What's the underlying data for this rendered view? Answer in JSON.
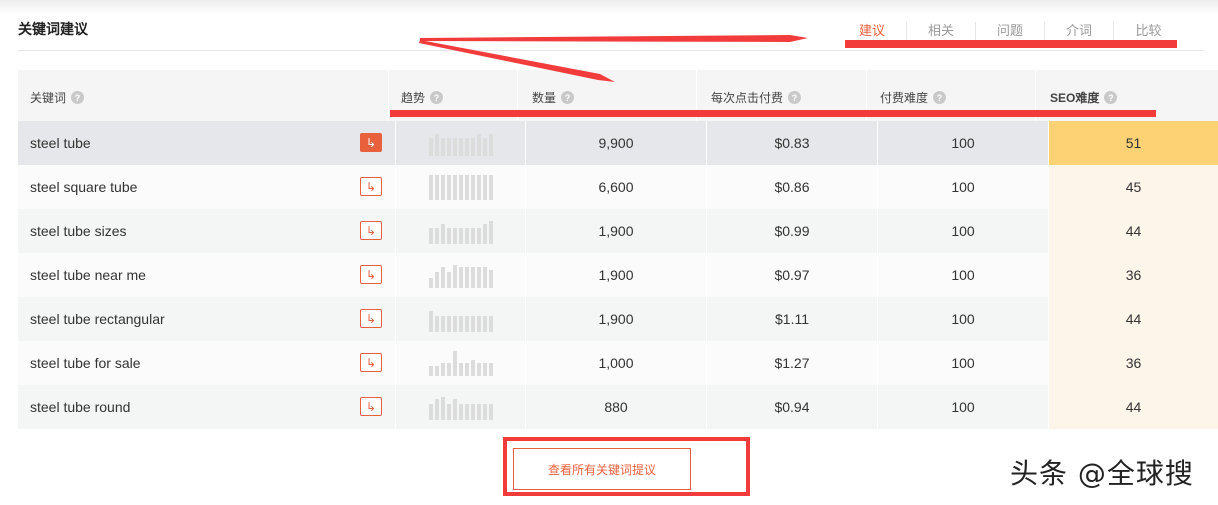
{
  "panel": {
    "title": "关键词建议"
  },
  "tabs": [
    {
      "label": "建议",
      "active": true
    },
    {
      "label": "相关",
      "active": false
    },
    {
      "label": "问题",
      "active": false
    },
    {
      "label": "介词",
      "active": false
    },
    {
      "label": "比较",
      "active": false
    }
  ],
  "columns": {
    "keyword": "关键词",
    "trend": "趋势",
    "volume": "数量",
    "cpc": "每次点击付费",
    "paid_difficulty": "付费难度",
    "seo_difficulty": "SEO难度"
  },
  "help_glyph": "?",
  "link_glyph": "↳",
  "rows": [
    {
      "keyword": "steel tube",
      "volume": "9,900",
      "cpc": "$0.83",
      "paid_difficulty": "100",
      "seo_difficulty": "51",
      "highlighted": true,
      "trend": [
        0.7,
        0.85,
        0.7,
        0.7,
        0.7,
        0.7,
        0.7,
        0.7,
        0.85,
        0.7,
        0.85
      ]
    },
    {
      "keyword": "steel square tube",
      "volume": "6,600",
      "cpc": "$0.86",
      "paid_difficulty": "100",
      "seo_difficulty": "45",
      "highlighted": false,
      "trend": [
        0.95,
        0.95,
        0.95,
        0.95,
        0.95,
        0.95,
        0.95,
        0.95,
        0.95,
        0.95,
        0.95
      ]
    },
    {
      "keyword": "steel tube sizes",
      "volume": "1,900",
      "cpc": "$0.99",
      "paid_difficulty": "100",
      "seo_difficulty": "44",
      "highlighted": false,
      "trend": [
        0.6,
        0.6,
        0.75,
        0.6,
        0.6,
        0.6,
        0.6,
        0.6,
        0.6,
        0.75,
        0.9
      ]
    },
    {
      "keyword": "steel tube near me",
      "volume": "1,900",
      "cpc": "$0.97",
      "paid_difficulty": "100",
      "seo_difficulty": "36",
      "highlighted": false,
      "trend": [
        0.4,
        0.6,
        0.8,
        0.6,
        0.9,
        0.8,
        0.8,
        0.8,
        0.8,
        0.8,
        0.7
      ]
    },
    {
      "keyword": "steel tube rectangular",
      "volume": "1,900",
      "cpc": "$1.11",
      "paid_difficulty": "100",
      "seo_difficulty": "44",
      "highlighted": false,
      "trend": [
        0.8,
        0.6,
        0.6,
        0.6,
        0.6,
        0.6,
        0.6,
        0.6,
        0.6,
        0.6,
        0.6
      ]
    },
    {
      "keyword": "steel tube for sale",
      "volume": "1,000",
      "cpc": "$1.27",
      "paid_difficulty": "100",
      "seo_difficulty": "36",
      "highlighted": false,
      "trend": [
        0.4,
        0.4,
        0.5,
        0.5,
        0.95,
        0.5,
        0.5,
        0.6,
        0.5,
        0.5,
        0.5
      ]
    },
    {
      "keyword": "steel tube round",
      "volume": "880",
      "cpc": "$0.94",
      "paid_difficulty": "100",
      "seo_difficulty": "44",
      "highlighted": false,
      "trend": [
        0.6,
        0.8,
        0.9,
        0.6,
        0.8,
        0.6,
        0.6,
        0.6,
        0.6,
        0.6,
        0.6
      ]
    }
  ],
  "cta": {
    "label": "查看所有关键词提议"
  },
  "watermark": "头条 @全球搜",
  "colors": {
    "accent": "#e8603c",
    "annotation": "#f23c3c",
    "seo_highlight": "#fcd274"
  }
}
